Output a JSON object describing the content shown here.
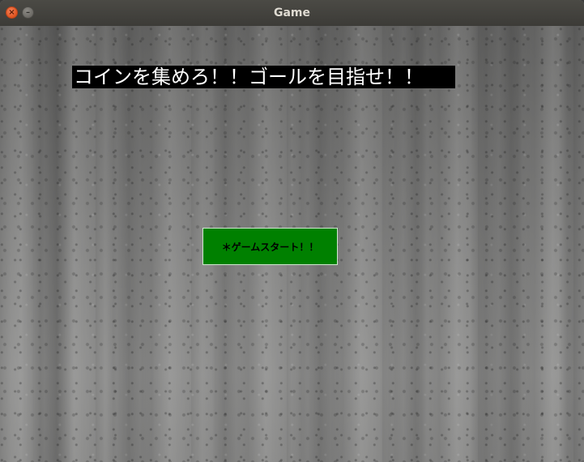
{
  "window": {
    "title": "Game"
  },
  "game": {
    "headline": "コインを集めろ！！ゴールを目指せ！！",
    "start_button_label": "＊ゲームスタート！！"
  },
  "colors": {
    "button_background": "#008000",
    "headline_background": "#000000",
    "headline_text": "#ffffff"
  },
  "icons": {
    "close": "close-icon",
    "minimize": "minimize-icon"
  }
}
